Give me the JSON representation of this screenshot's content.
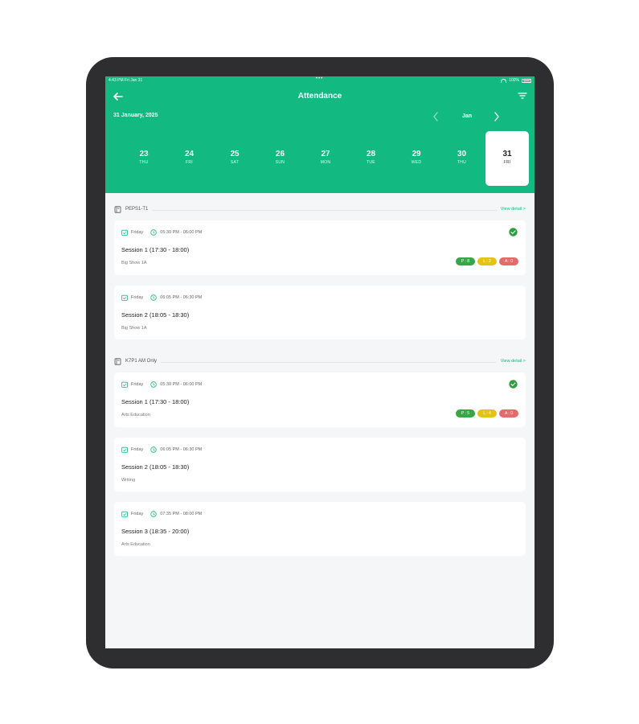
{
  "status_bar": {
    "time": "4:43 PM",
    "date": "Fri Jan 31",
    "dots": "•••",
    "battery": "100%"
  },
  "header": {
    "title": "Attendance",
    "selected_date": "31 January, 2025",
    "month": "Jan",
    "accent_color": "#12b981",
    "days": [
      {
        "num": "23",
        "wd": "THU"
      },
      {
        "num": "24",
        "wd": "FRI"
      },
      {
        "num": "25",
        "wd": "SAT"
      },
      {
        "num": "26",
        "wd": "SUN"
      },
      {
        "num": "27",
        "wd": "MON"
      },
      {
        "num": "28",
        "wd": "TUE"
      },
      {
        "num": "29",
        "wd": "WED"
      },
      {
        "num": "30",
        "wd": "THU"
      },
      {
        "num": "31",
        "wd": "FRI"
      }
    ],
    "selected_day_index": 8
  },
  "groups": [
    {
      "name": "PEPS1-T1",
      "view_detail": "View detail >",
      "cards": [
        {
          "day": "Friday",
          "time": "05:30 PM - 06:00 PM",
          "title": "Session 1 (17:30 - 18:00)",
          "subject": "Big Show 1A",
          "checked": true,
          "badges": {
            "p": "P : 8",
            "l": "L : 2",
            "a": "A : 0"
          }
        },
        {
          "day": "Friday",
          "time": "06:05 PM - 06:30 PM",
          "title": "Session 2 (18:05 - 18:30)",
          "subject": "Big Show 1A",
          "checked": false
        }
      ]
    },
    {
      "name": "K7P1 AM Only",
      "view_detail": "View detail >",
      "cards": [
        {
          "day": "Friday",
          "time": "05:30 PM - 06:00 PM",
          "title": "Session 1 (17:30 - 18:00)",
          "subject": "Arts Education",
          "checked": true,
          "badges": {
            "p": "P : 5",
            "l": "L : 4",
            "a": "A : 0"
          }
        },
        {
          "day": "Friday",
          "time": "06:05 PM - 06:30 PM",
          "title": "Session 2 (18:05 - 18:30)",
          "subject": "Writing",
          "checked": false
        },
        {
          "day": "Friday",
          "time": "07:35 PM - 08:00 PM",
          "title": "Session 3 (18:35 - 20:00)",
          "subject": "Arts Education",
          "checked": false
        }
      ]
    }
  ]
}
